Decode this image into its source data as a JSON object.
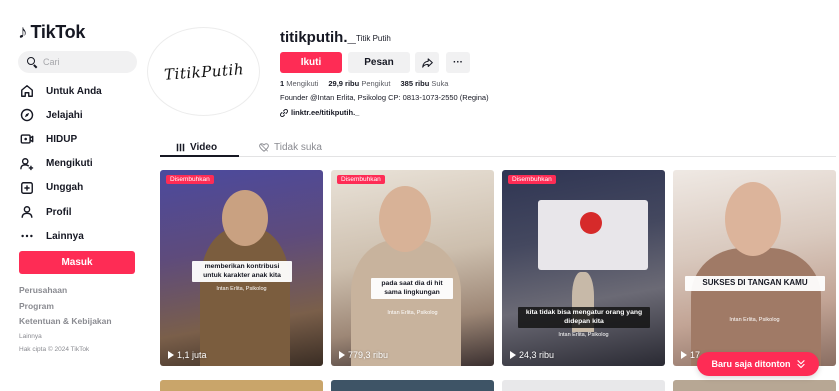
{
  "brand": {
    "name": "TikTok",
    "logo_icon": "tiktok-note-icon"
  },
  "search": {
    "placeholder": "Cari"
  },
  "sidebar": {
    "items": [
      {
        "label": "Untuk Anda",
        "icon": "home-icon"
      },
      {
        "label": "Jelajahi",
        "icon": "compass-icon"
      },
      {
        "label": "HIDUP",
        "icon": "live-icon"
      },
      {
        "label": "Mengikuti",
        "icon": "following-icon"
      },
      {
        "label": "Unggah",
        "icon": "upload-icon"
      },
      {
        "label": "Profil",
        "icon": "profile-icon"
      },
      {
        "label": "Lainnya",
        "icon": "more-icon"
      }
    ],
    "login_label": "Masuk",
    "footer": {
      "company": "Perusahaan",
      "program": "Program",
      "terms": "Ketentuan & Kebijakan",
      "more": "Lainnya",
      "copyright": "Hak cipta © 2024 TikTok"
    }
  },
  "profile": {
    "avatar_text": "TitikPutih",
    "username": "titikputih._",
    "nickname": "Titik Putih",
    "follow_label": "Ikuti",
    "message_label": "Pesan",
    "more_label": "···",
    "stats": {
      "following_count": "1",
      "following_label": "Mengikuti",
      "followers_count": "29,9 ribu",
      "followers_label": "Pengikut",
      "likes_count": "385 ribu",
      "likes_label": "Suka"
    },
    "bio": "Founder @Intan Erlita, Psikolog CP: 0813-1073-2550 (Regina)",
    "link": "linktr.ee/titikputih._"
  },
  "tabs": {
    "video_label": "Video",
    "liked_label": "Tidak suka"
  },
  "videos": [
    {
      "badge": "Disembuhkan",
      "caption": "memberikan kontribusi untuk karakter anak kita",
      "subtitle": "Intan Erlita, Psikolog",
      "views": "1,1 juta"
    },
    {
      "badge": "Disembuhkan",
      "caption": "pada saat dia di hit sama lingkungan",
      "subtitle": "Intan Erlita, Psikolog",
      "views": "779,3 ribu"
    },
    {
      "badge": "Disembuhkan",
      "caption": "kita tidak bisa mengatur orang yang didepan kita",
      "subtitle": "Intan Erlita, Psikolog",
      "views": "24,3 ribu"
    },
    {
      "badge": "",
      "caption": "SUKSES DI TANGAN KAMU",
      "subtitle": "Intan Erlita, Psikolog",
      "views": "17"
    }
  ],
  "fab": {
    "label": "Baru saja ditonton",
    "icon": "chevron-double-down-icon"
  },
  "colors": {
    "accent": "#fe2c55",
    "text": "#161823",
    "muted": "#8a8b91"
  }
}
